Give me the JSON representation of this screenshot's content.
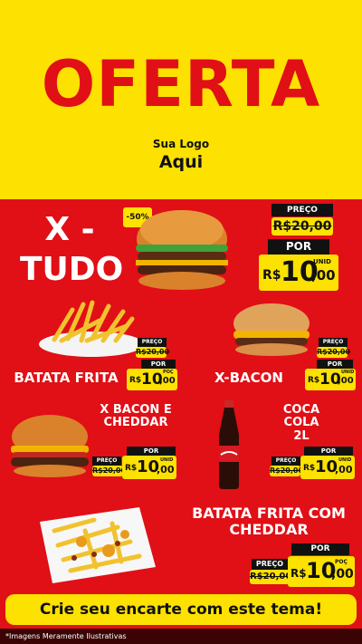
{
  "header": {
    "title": "OFERTA",
    "logo_line1": "Sua Logo",
    "logo_line2": "Aqui"
  },
  "colors": {
    "red": "#e10f16",
    "yellow": "#fde100",
    "black": "#111111"
  },
  "products": [
    {
      "id": "xtudo",
      "name_l1": "X -",
      "name_l2": "TUDO",
      "discount": "-50%",
      "preco_label": "PREÇO",
      "old_price": "R$20,00",
      "por_label": "POR",
      "currency": "R$",
      "price_int": "10",
      "price_dec": ",00",
      "unit": "UNID",
      "icon": "burger"
    },
    {
      "id": "batata",
      "name": "BATATA FRITA",
      "preco_label": "PREÇO",
      "old_price": "R$20,00",
      "por_label": "POR",
      "currency": "R$",
      "price_int": "10",
      "price_dec": ",00",
      "unit": "POÇ",
      "icon": "fries"
    },
    {
      "id": "xbacon",
      "name": "X-BACON",
      "preco_label": "PREÇO",
      "old_price": "R$20,00",
      "por_label": "POR",
      "currency": "R$",
      "price_int": "10",
      "price_dec": ",00",
      "unit": "UNID",
      "icon": "burger"
    },
    {
      "id": "xbaconcheddar",
      "name_l1": "X BACON E",
      "name_l2": "CHEDDAR",
      "preco_label": "PREÇO",
      "old_price": "R$20,00",
      "por_label": "POR",
      "currency": "R$",
      "price_int": "10",
      "price_dec": ",00",
      "unit": "UNID",
      "icon": "burger"
    },
    {
      "id": "coca",
      "name_l1": "COCA COLA",
      "name_l2": "2L",
      "preco_label": "PREÇO",
      "old_price": "R$20,00",
      "por_label": "POR",
      "currency": "R$",
      "price_int": "10",
      "price_dec": ",00",
      "unit": "UNID",
      "icon": "soda-bottle"
    },
    {
      "id": "batatacheddar",
      "name_l1": "BATATA FRITA COM",
      "name_l2": "CHEDDAR",
      "preco_label": "PREÇO",
      "old_price": "R$20,00",
      "por_label": "POR",
      "currency": "R$",
      "price_int": "10",
      "price_dec": ",00",
      "unit": "POÇ",
      "icon": "cheese-fries"
    }
  ],
  "footer": {
    "cta": "Crie seu encarte com este tema!",
    "disclaimer": "*Imagens Meramente Ilustrativas"
  }
}
